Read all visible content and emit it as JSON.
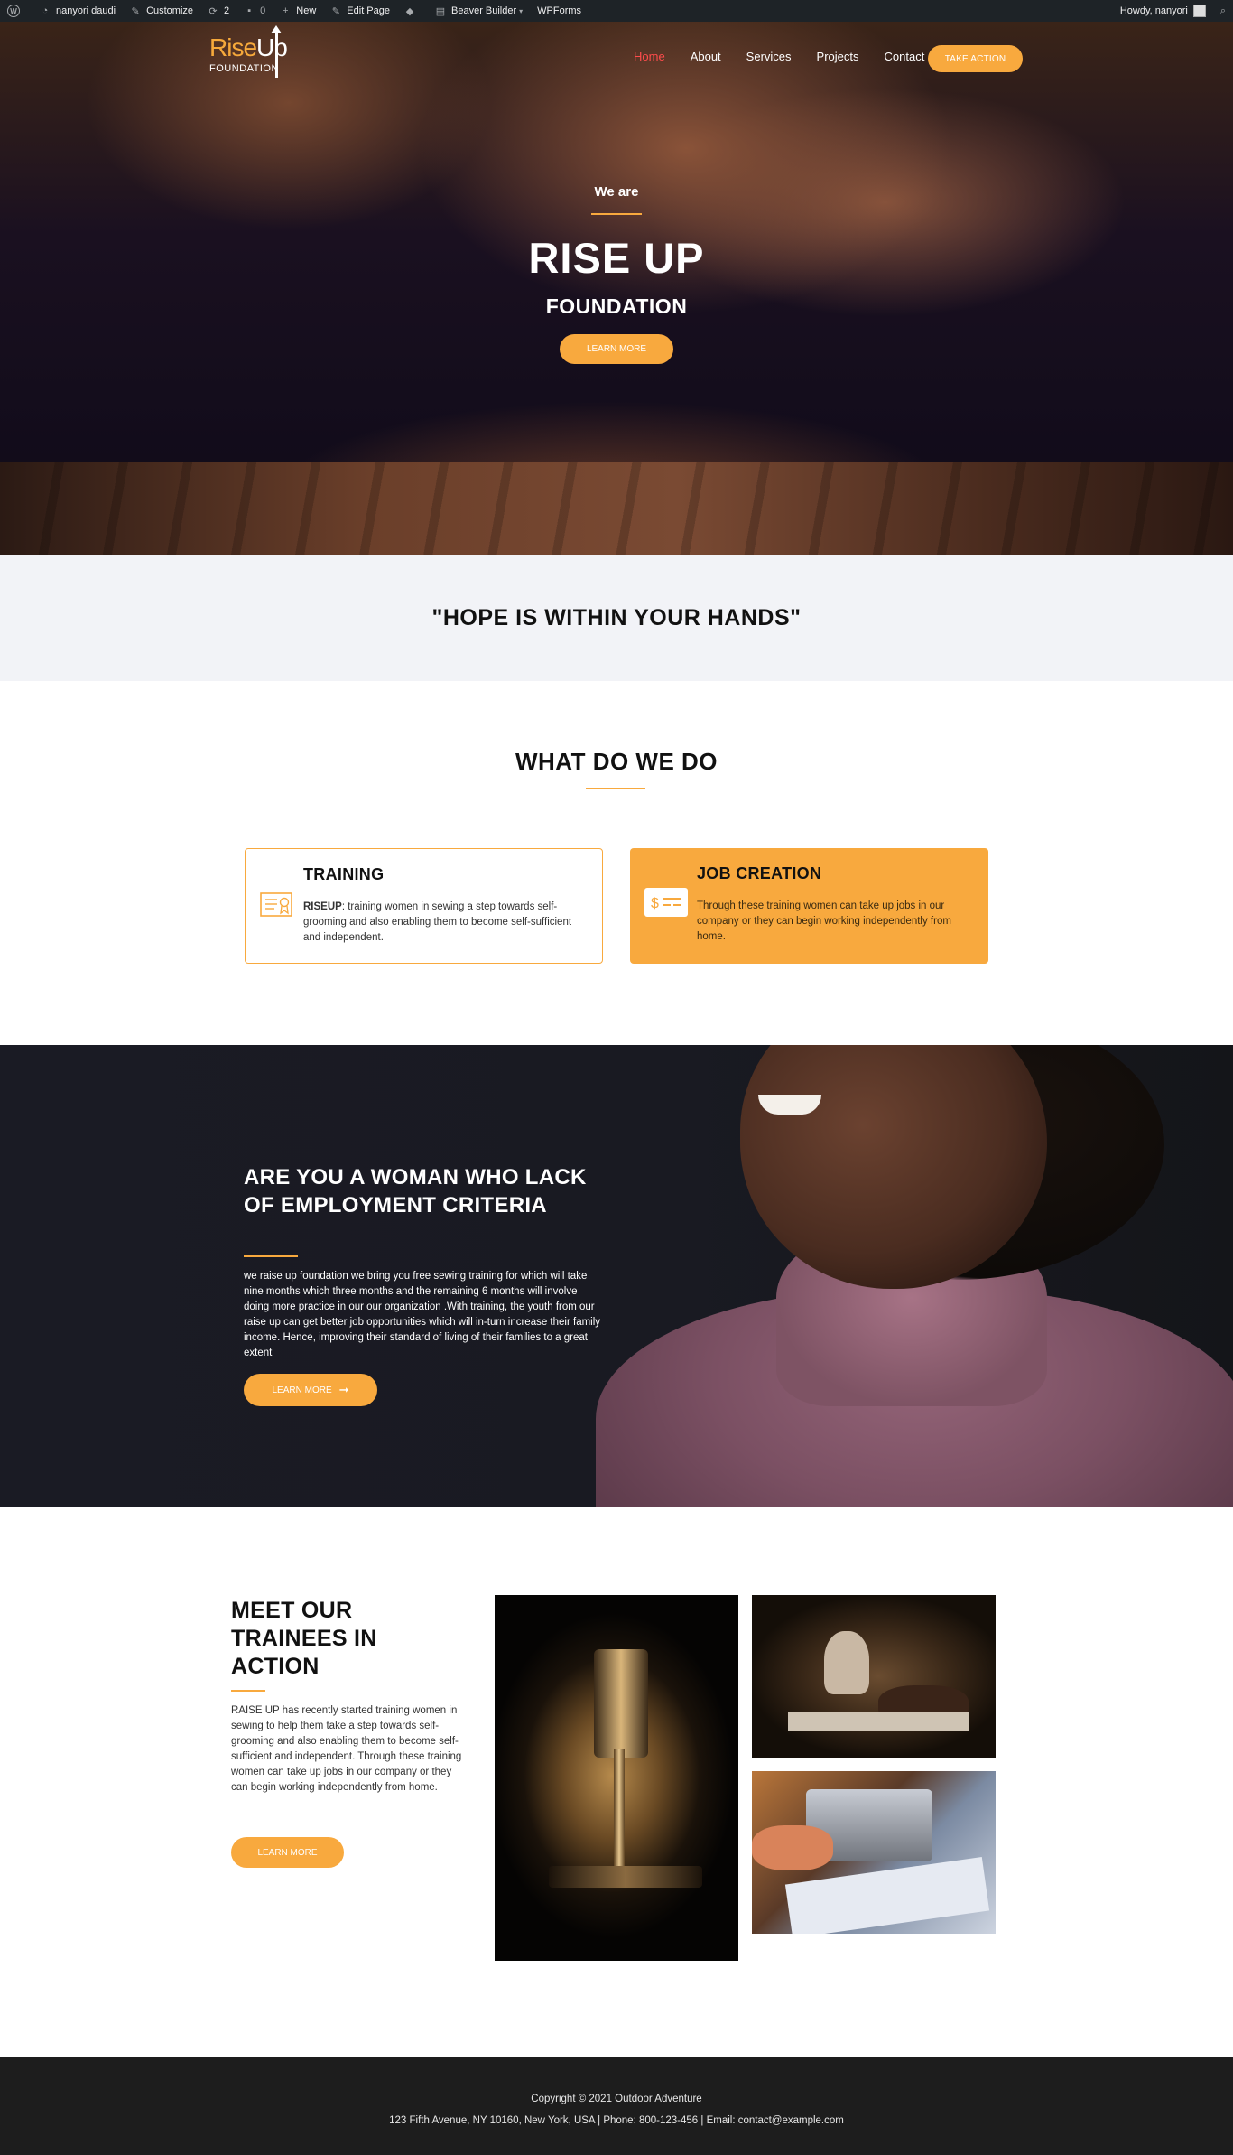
{
  "admin_bar": {
    "items": [
      "nanyori daudi",
      "Customize",
      "2",
      "0",
      "New",
      "Edit Page",
      "Beaver Builder",
      "WPForms"
    ],
    "greeting": "Howdy, nanyori"
  },
  "site": {
    "logo_rise": "Rise",
    "logo_up": "Up",
    "logo_sub": "FOUNDATION",
    "nav": [
      "Home",
      "About",
      "Services",
      "Projects",
      "Contact"
    ],
    "cta": "TAKE ACTION",
    "brand_color": "#f8a93e",
    "active_nav_color": "#ff4c4c"
  },
  "hero": {
    "kicker": "We are",
    "title": "RISE UP",
    "subtitle": "FOUNDATION",
    "button": "LEARN MORE"
  },
  "quote": "\"HOPE IS WITHIN YOUR HANDS\"",
  "what_we_do": {
    "title": "WHAT DO WE DO",
    "cards": [
      {
        "title": "TRAINING",
        "lead": "RISEUP",
        "text": ": training women in sewing a step towards self-grooming and also enabling them to become self-sufficient and independent.",
        "icon": "certificate-icon"
      },
      {
        "title": "JOB CREATION",
        "text": "Through these training women can take up jobs in our company or they can begin working independently from home.",
        "icon": "money-card-icon"
      }
    ]
  },
  "woman_section": {
    "title": "ARE YOU A WOMAN WHO LACK OF EMPLOYMENT CRITERIA",
    "text": "we raise up foundation we bring you free sewing training for which will take nine months which three months and the remaining 6 months will involve doing more practice in our our organization  .With training, the youth from our raise up can get better job opportunities which will in-turn increase their family income. Hence, improving their standard of living of their families to a great extent",
    "button": "LEARN MORE"
  },
  "trainees": {
    "title": "MEET OUR TRAINEES IN ACTION",
    "text": " RAISE UP has recently started training women in sewing to help them take a step towards self- grooming and also enabling them to become self-sufficient and independent. Through these training women can take up jobs in our company or they can begin working independently from home.",
    "button": "LEARN MORE"
  },
  "footer": {
    "copyright": "Copyright © 2021 Outdoor Adventure",
    "contact": "123 Fifth Avenue, NY 10160, New York, USA | Phone: 800-123-456 | Email: contact@example.com"
  }
}
